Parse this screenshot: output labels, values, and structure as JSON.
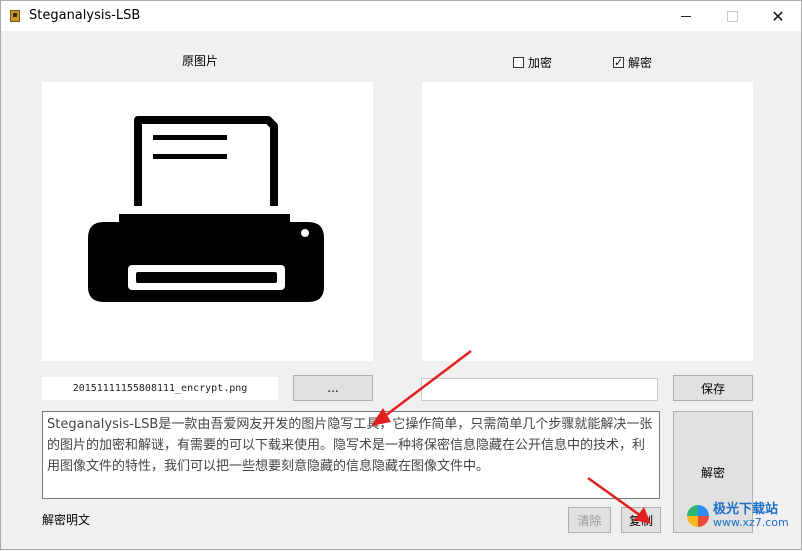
{
  "window": {
    "title": "Steganalysis-LSB"
  },
  "left_panel": {
    "label": "原图片",
    "filename": "20151111155808111_encrypt.png",
    "browse_label": "..."
  },
  "right_panel": {
    "encrypt_label": "加密",
    "encrypt_checked": false,
    "decrypt_label": "解密",
    "decrypt_checked": true,
    "path_value": "",
    "save_label": "保存"
  },
  "text_area": {
    "content": "Steganalysis-LSB是一款由吾爱网友开发的图片隐写工具，它操作简单，只需简单几个步骤就能解决一张的图片的加密和解谜，有需要的可以下载来使用。隐写术是一种将保密信息隐藏在公开信息中的技术，利用图像文件的特性，我们可以把一些想要刻意隐藏的信息隐藏在图像文件中。"
  },
  "bottom": {
    "status_label": "解密明文",
    "clear_label": "清除",
    "copy_label": "复制",
    "decrypt_button_label": "解密"
  },
  "watermark": {
    "cn": "极光下载站",
    "en": "www.xz7.com"
  },
  "colors": {
    "arrow": "#e02020",
    "printer": "#000000"
  }
}
